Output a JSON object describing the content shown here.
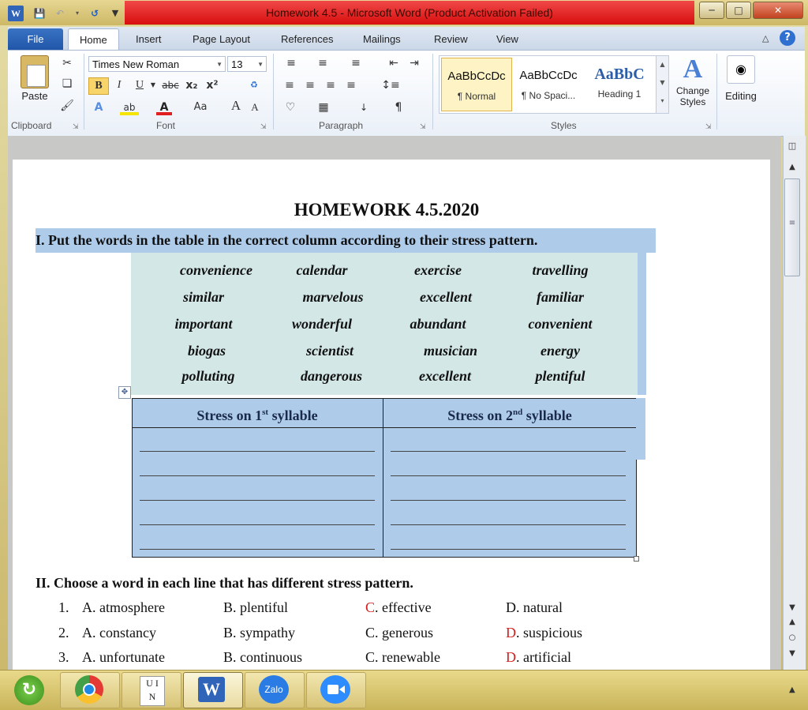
{
  "titlebar": {
    "title": "Homework 4.5  -  Microsoft Word (Product Activation Failed)",
    "minimize_icon": "minimize-icon",
    "maximize_icon": "maximize-icon",
    "close_icon": "close-icon",
    "accent_color": "#e02020"
  },
  "tabs": [
    "File",
    "Home",
    "Insert",
    "Page Layout",
    "References",
    "Mailings",
    "Review",
    "View"
  ],
  "ribbon": {
    "clipboard": {
      "paste": "Paste",
      "label": "Clipboard"
    },
    "font": {
      "name": "Times New Roman",
      "size": "13",
      "label": "Font",
      "grow": "A",
      "shrink": "A",
      "change_case": "Aa"
    },
    "paragraph": {
      "label": "Paragraph"
    },
    "styles": {
      "label": "Styles",
      "items": [
        {
          "preview": "AaBbCcDc",
          "name": "¶ Normal"
        },
        {
          "preview": "AaBbCcDc",
          "name": "¶ No Spaci..."
        },
        {
          "preview": "AaBbC",
          "name": "Heading 1"
        }
      ],
      "change_styles": "Change Styles",
      "editing": "Editing"
    }
  },
  "document": {
    "title": "HOMEWORK  4.5.2020",
    "q1": "I.   Put the words in the table in the correct column according to their stress pattern.",
    "words": [
      [
        "convenience",
        "calendar",
        "exercise",
        "travelling"
      ],
      [
        "similar",
        "marvelous",
        "excellent",
        "familiar"
      ],
      [
        "important",
        "wonderful",
        "abundant",
        "convenient"
      ],
      [
        "biogas",
        "scientist",
        "musician",
        "energy"
      ],
      [
        "polluting",
        "dangerous",
        "excellent",
        "plentiful"
      ]
    ],
    "table": {
      "col1": {
        "pre": "Stress on 1",
        "sup": "st",
        "post": " syllable"
      },
      "col2": {
        "pre": "Stress on 2",
        "sup": "nd",
        "post": " syllable"
      }
    },
    "q2": "II.  Choose a word in each line that has different stress pattern.",
    "q2_items": [
      {
        "num": "1.",
        "a": "A. atmosphere",
        "b": "B. plentiful",
        "c_letter": "C",
        "c": ". effective",
        "d_letter": "D",
        "d": ". natural",
        "marked": "C"
      },
      {
        "num": "2.",
        "a": "A. constancy",
        "b": "B. sympathy",
        "c_letter": "C",
        "c": ". generous",
        "d_letter": "D",
        "d": ". suspicious",
        "marked": "D"
      },
      {
        "num": "3.",
        "a": "A. unfortunate",
        "b": "B. continuous",
        "c_letter": "C",
        "c": ". renewable",
        "d_letter": "D",
        "d": ". artificial",
        "marked": "D"
      }
    ]
  },
  "taskbar": {
    "items": [
      "refresh-app-icon",
      "chrome-icon",
      "unikey-icon",
      "word-icon",
      "zalo-icon",
      "zoom-icon"
    ],
    "unikey_top": "U I",
    "unikey_bottom": "N",
    "zalo_label": "Zalo"
  }
}
